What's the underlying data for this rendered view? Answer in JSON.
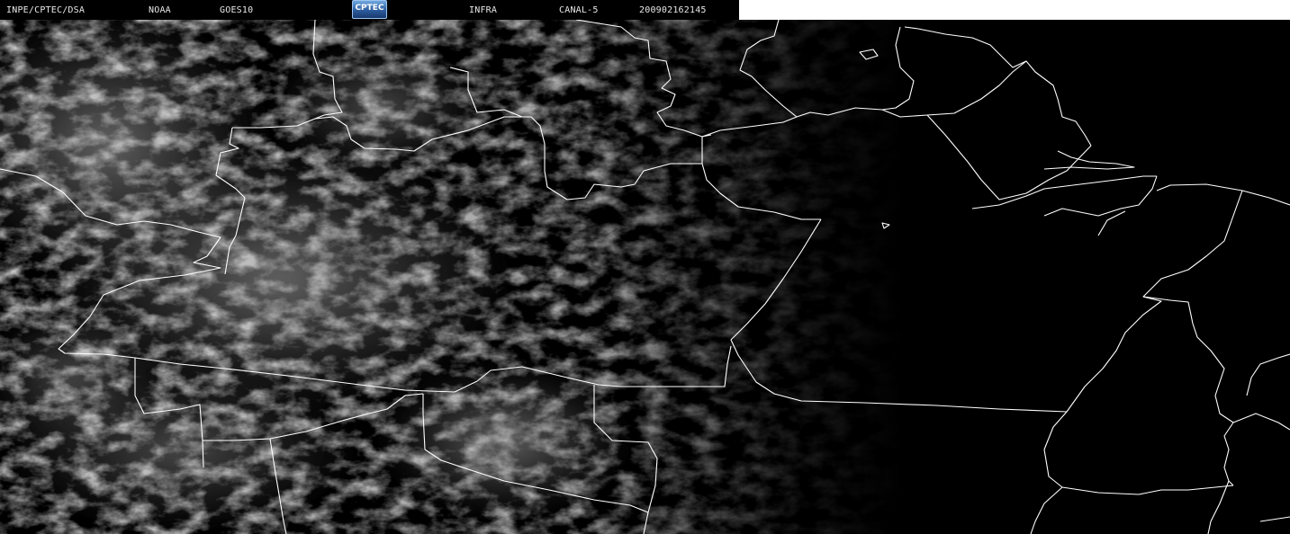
{
  "header": {
    "organization": "INPE/CPTEC/DSA",
    "agency": "NOAA",
    "satellite": "GOES10",
    "logo_text": "CPTEC",
    "band": "INFRA",
    "channel": "CANAL-5",
    "timestamp": "200902162145"
  },
  "colors": {
    "background": "#000000",
    "boundary_lines": "#ffffff",
    "cloud_tone": "#6b6b6b",
    "header_blank": "#ffffff"
  }
}
